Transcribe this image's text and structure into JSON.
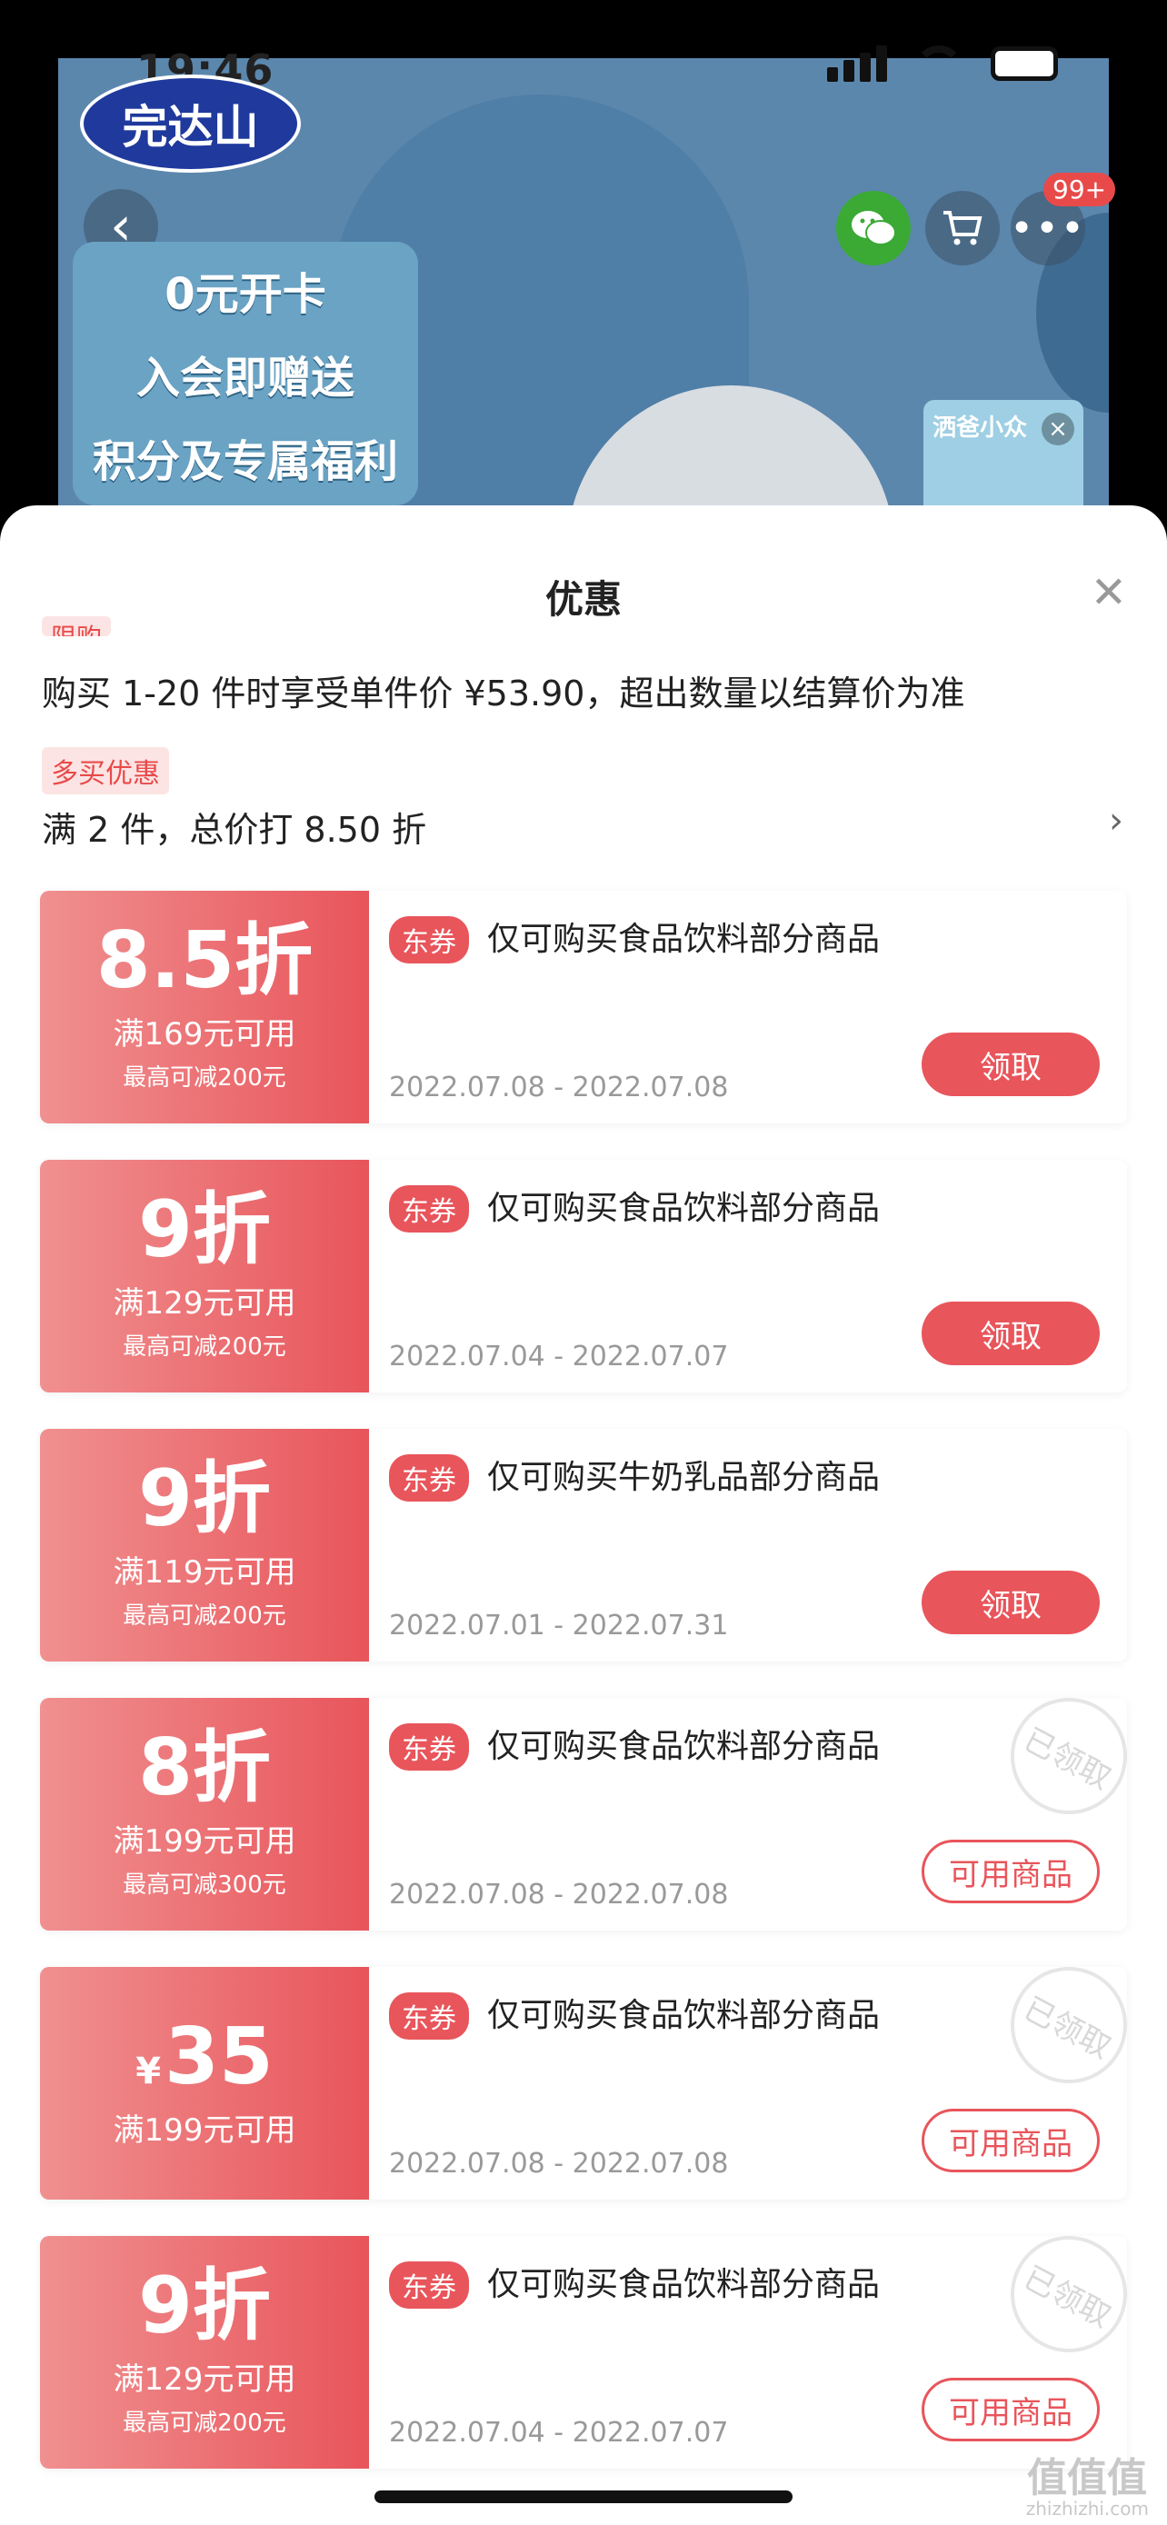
{
  "status": {
    "time": "19:46"
  },
  "header": {
    "logo_text": "完达山",
    "promo_lines": [
      "0元开卡",
      "入会即赠送",
      "积分及专属福利"
    ],
    "badge": "99+",
    "thumb_text": "洒爸小众"
  },
  "sheet": {
    "title": "优惠",
    "cut_tag": "限购",
    "limit_text": "购买 1-20 件时享受单件价 ¥53.90，超出数量以结算价为准",
    "multi_tag": "多买优惠",
    "multi_text": "满 2 件，总价打 8.50 折"
  },
  "coupons": [
    {
      "amount": "8.5折",
      "cond": "满169元可用",
      "max": "最高可减200元",
      "tag": "东券",
      "desc": "仅可购买食品饮料部分商品",
      "date": "2022.07.08 - 2022.07.08",
      "button": "领取"
    },
    {
      "amount": "9折",
      "cond": "满129元可用",
      "max": "最高可减200元",
      "tag": "东券",
      "desc": "仅可购买食品饮料部分商品",
      "date": "2022.07.04 - 2022.07.07",
      "button": "领取"
    },
    {
      "amount": "9折",
      "cond": "满119元可用",
      "max": "最高可减200元",
      "tag": "东券",
      "desc": "仅可购买牛奶乳品部分商品",
      "date": "2022.07.01 - 2022.07.31",
      "button": "领取"
    },
    {
      "amount": "8折",
      "cond": "满199元可用",
      "max": "最高可减300元",
      "tag": "东券",
      "desc": "仅可购买食品饮料部分商品",
      "date": "2022.07.08 - 2022.07.08",
      "button": "可用商品",
      "stamp": "已领取"
    },
    {
      "currency": "¥",
      "amount": "35",
      "cond": "满199元可用",
      "tag": "东券",
      "desc": "仅可购买食品饮料部分商品",
      "date": "2022.07.08 - 2022.07.08",
      "button": "可用商品",
      "stamp": "已领取"
    },
    {
      "amount": "9折",
      "cond": "满129元可用",
      "max": "最高可减200元",
      "tag": "东券",
      "desc": "仅可购买食品饮料部分商品",
      "date": "2022.07.04 - 2022.07.07",
      "button": "可用商品",
      "stamp": "已领取"
    }
  ],
  "watermark": {
    "logo": "值值值",
    "site": "zhizhizhi.com"
  }
}
